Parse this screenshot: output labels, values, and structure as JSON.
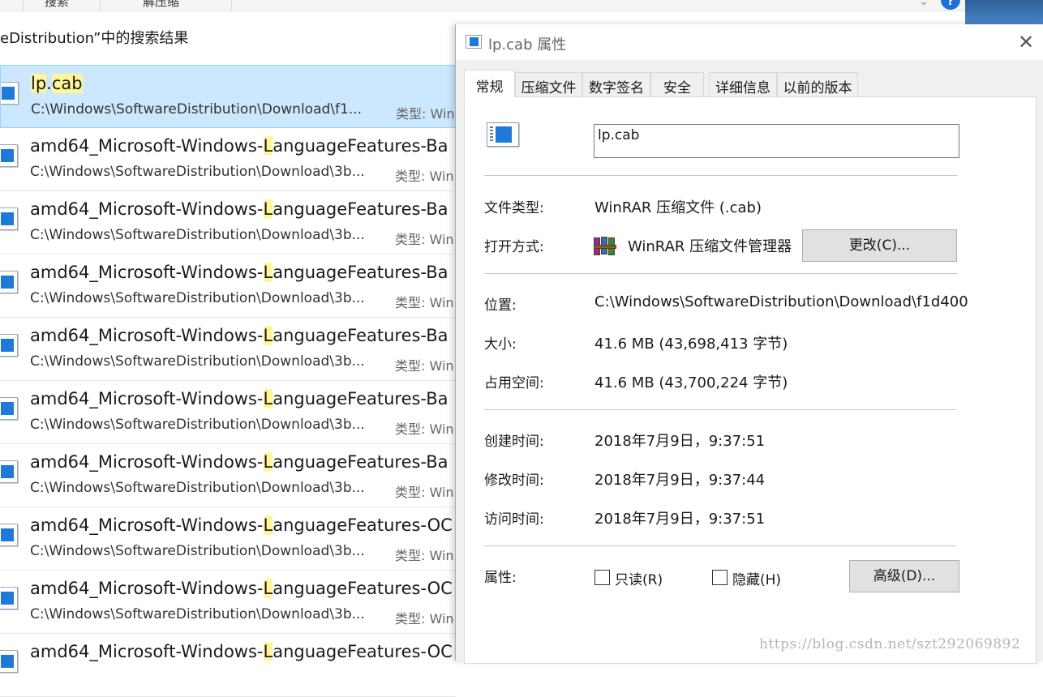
{
  "explorer": {
    "ribbon_tabs": [
      "搜索",
      "解压缩"
    ],
    "search_title": "eDistribution”中的搜索结果",
    "results": [
      {
        "name_pre": "",
        "name_hl": "lp",
        "name_mid": ".",
        "name_hl2": "cab",
        "name_post": "",
        "path": "C:\\Windows\\SoftwareDistribution\\Download\\f1...",
        "type": "类型: Win",
        "selected": true
      },
      {
        "name_pre": "amd64_Microsoft-Windows-",
        "name_hl": "L",
        "name_mid": "anguageFeatures-Ba",
        "name_hl2": "",
        "name_post": "",
        "path": "C:\\Windows\\SoftwareDistribution\\Download\\3b...",
        "type": "类型: Win"
      },
      {
        "name_pre": "amd64_Microsoft-Windows-",
        "name_hl": "L",
        "name_mid": "anguageFeatures-Ba",
        "name_hl2": "",
        "name_post": "",
        "path": "C:\\Windows\\SoftwareDistribution\\Download\\3b...",
        "type": "类型: Win"
      },
      {
        "name_pre": "amd64_Microsoft-Windows-",
        "name_hl": "L",
        "name_mid": "anguageFeatures-Ba",
        "name_hl2": "",
        "name_post": "",
        "path": "C:\\Windows\\SoftwareDistribution\\Download\\3b...",
        "type": "类型: Win"
      },
      {
        "name_pre": "amd64_Microsoft-Windows-",
        "name_hl": "L",
        "name_mid": "anguageFeatures-Ba",
        "name_hl2": "",
        "name_post": "",
        "path": "C:\\Windows\\SoftwareDistribution\\Download\\3b...",
        "type": "类型: Win"
      },
      {
        "name_pre": "amd64_Microsoft-Windows-",
        "name_hl": "L",
        "name_mid": "anguageFeatures-Ba",
        "name_hl2": "",
        "name_post": "",
        "path": "C:\\Windows\\SoftwareDistribution\\Download\\3b...",
        "type": "类型: Win"
      },
      {
        "name_pre": "amd64_Microsoft-Windows-",
        "name_hl": "L",
        "name_mid": "anguageFeatures-Ba",
        "name_hl2": "",
        "name_post": "",
        "path": "C:\\Windows\\SoftwareDistribution\\Download\\3b...",
        "type": "类型: Win"
      },
      {
        "name_pre": "amd64_Microsoft-Windows-",
        "name_hl": "L",
        "name_mid": "anguageFeatures-OC",
        "name_hl2": "",
        "name_post": "",
        "path": "C:\\Windows\\SoftwareDistribution\\Download\\3b...",
        "type": "类型: Win"
      },
      {
        "name_pre": "amd64_Microsoft-Windows-",
        "name_hl": "L",
        "name_mid": "anguageFeatures-OC",
        "name_hl2": "",
        "name_post": "",
        "path": "C:\\Windows\\SoftwareDistribution\\Download\\3b...",
        "type": "类型: Win"
      },
      {
        "name_pre": "amd64_Microsoft-Windows-",
        "name_hl": "L",
        "name_mid": "anguageFeatures-OC",
        "name_hl2": "",
        "name_post": "",
        "path": "",
        "type": ""
      }
    ]
  },
  "dialog": {
    "title": "lp.cab 属性",
    "close_glyph": "✕",
    "tabs": [
      "常规",
      "压缩文件",
      "数字签名",
      "安全",
      "详细信息",
      "以前的版本"
    ],
    "file_name": "lp.cab",
    "labels": {
      "file_type": "文件类型:",
      "open_with": "打开方式:",
      "location": "位置:",
      "size": "大小:",
      "size_on_disk": "占用空间:",
      "created": "创建时间:",
      "modified": "修改时间:",
      "accessed": "访问时间:",
      "attributes": "属性:"
    },
    "values": {
      "file_type": "WinRAR 压缩文件 (.cab)",
      "open_with": "WinRAR 压缩文件管理器",
      "location": "C:\\Windows\\SoftwareDistribution\\Download\\f1d400",
      "size": "41.6 MB (43,698,413 字节)",
      "size_on_disk": "41.6 MB (43,700,224 字节)",
      "created": "2018年7月9日，9:37:51",
      "modified": "2018年7月9日，9:37:44",
      "accessed": "2018年7月9日，9:37:51"
    },
    "buttons": {
      "change": "更改(C)...",
      "advanced": "高级(D)..."
    },
    "checkboxes": {
      "readonly": "只读(R)",
      "hidden": "隐藏(H)"
    }
  },
  "watermark": "https://blog.csdn.net/szt292069892",
  "colors": {
    "selection_bg": "#cce8ff",
    "highlight": "#fff59a",
    "dialog_bg": "#f0f0f0",
    "file_icon_blue": "#1f79d6",
    "help_blue": "#1e6fd6"
  }
}
